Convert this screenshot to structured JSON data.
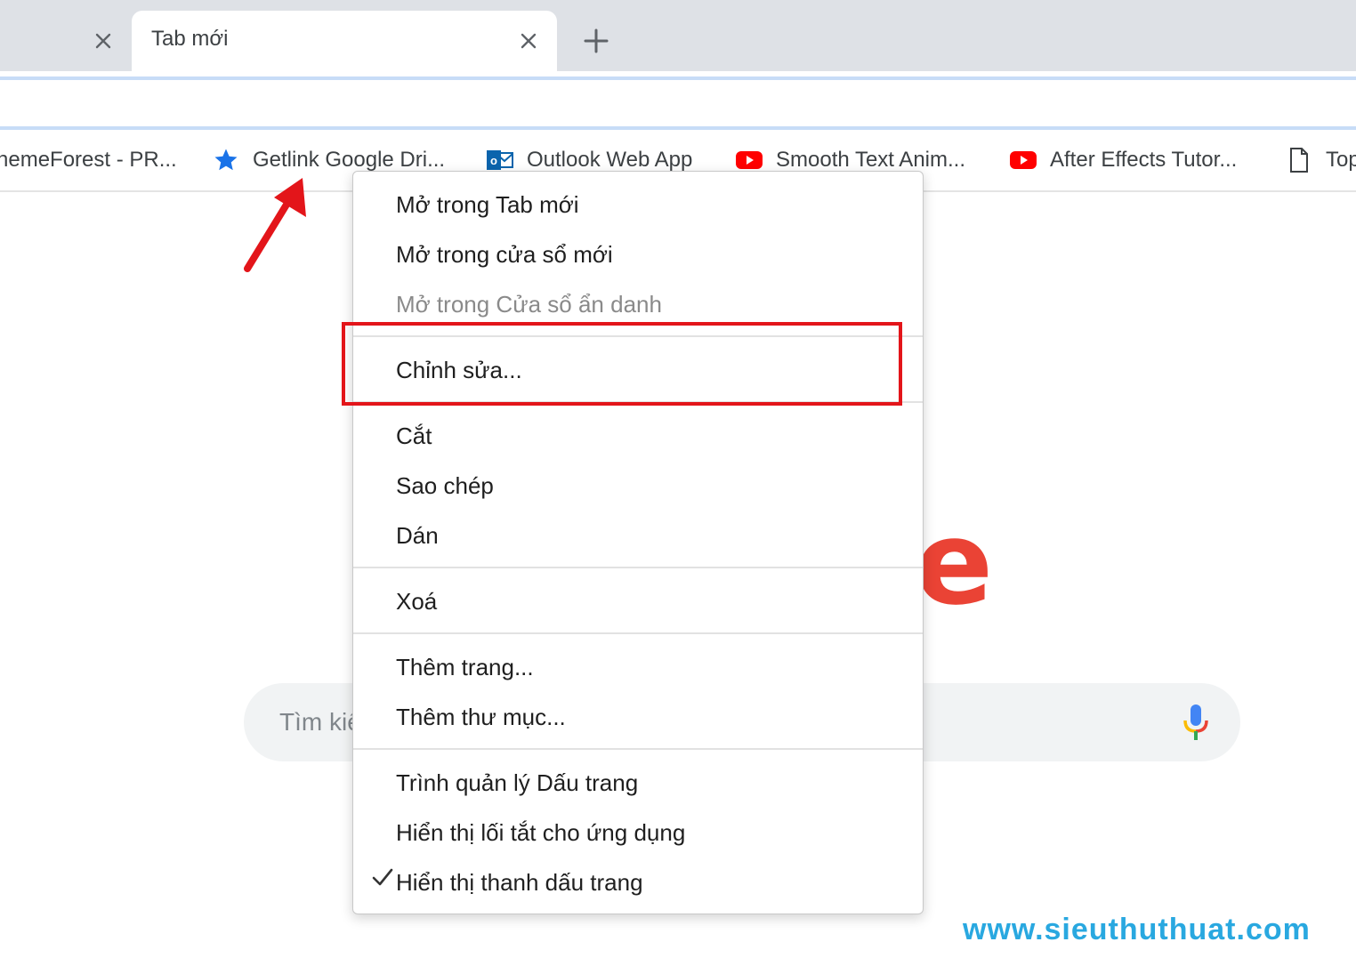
{
  "tabs": {
    "active_title": "Tab mới",
    "new_tab_symbol": "+"
  },
  "bookmarks": [
    {
      "label": "hemeForest - PR...",
      "icon": "none"
    },
    {
      "label": "Getlink Google Dri...",
      "icon": "star-icon"
    },
    {
      "label": "Outlook Web App",
      "icon": "outlook-icon"
    },
    {
      "label": "Smooth Text Anim...",
      "icon": "youtube-icon"
    },
    {
      "label": "After Effects Tutor...",
      "icon": "youtube-icon"
    },
    {
      "label": "Top",
      "icon": "page-icon"
    }
  ],
  "search": {
    "placeholder": "Tìm kiế"
  },
  "logo_fragment": "e",
  "context_menu": {
    "open_new_tab": "Mở trong Tab mới",
    "open_new_window": "Mở trong cửa sổ mới",
    "open_incognito": "Mở trong Cửa sổ ẩn danh",
    "edit": "Chỉnh sửa...",
    "cut": "Cắt",
    "copy": "Sao chép",
    "paste": "Dán",
    "delete": "Xoá",
    "add_page": "Thêm trang...",
    "add_folder": "Thêm thư mục...",
    "bookmark_manager": "Trình quản lý Dấu trang",
    "show_apps_shortcut": "Hiển thị lối tắt cho ứng dụng",
    "show_bookmarks_bar": "Hiển thị thanh dấu trang",
    "show_bookmarks_bar_checked": true
  },
  "watermark": "www.sieuthuthuat.com",
  "colors": {
    "highlight": "#e3151a",
    "arrow": "#e3151a",
    "star": "#1a73e8",
    "youtube": "#ff0000",
    "outlook": "#0a64ad",
    "watermark": "#29a8e0"
  }
}
